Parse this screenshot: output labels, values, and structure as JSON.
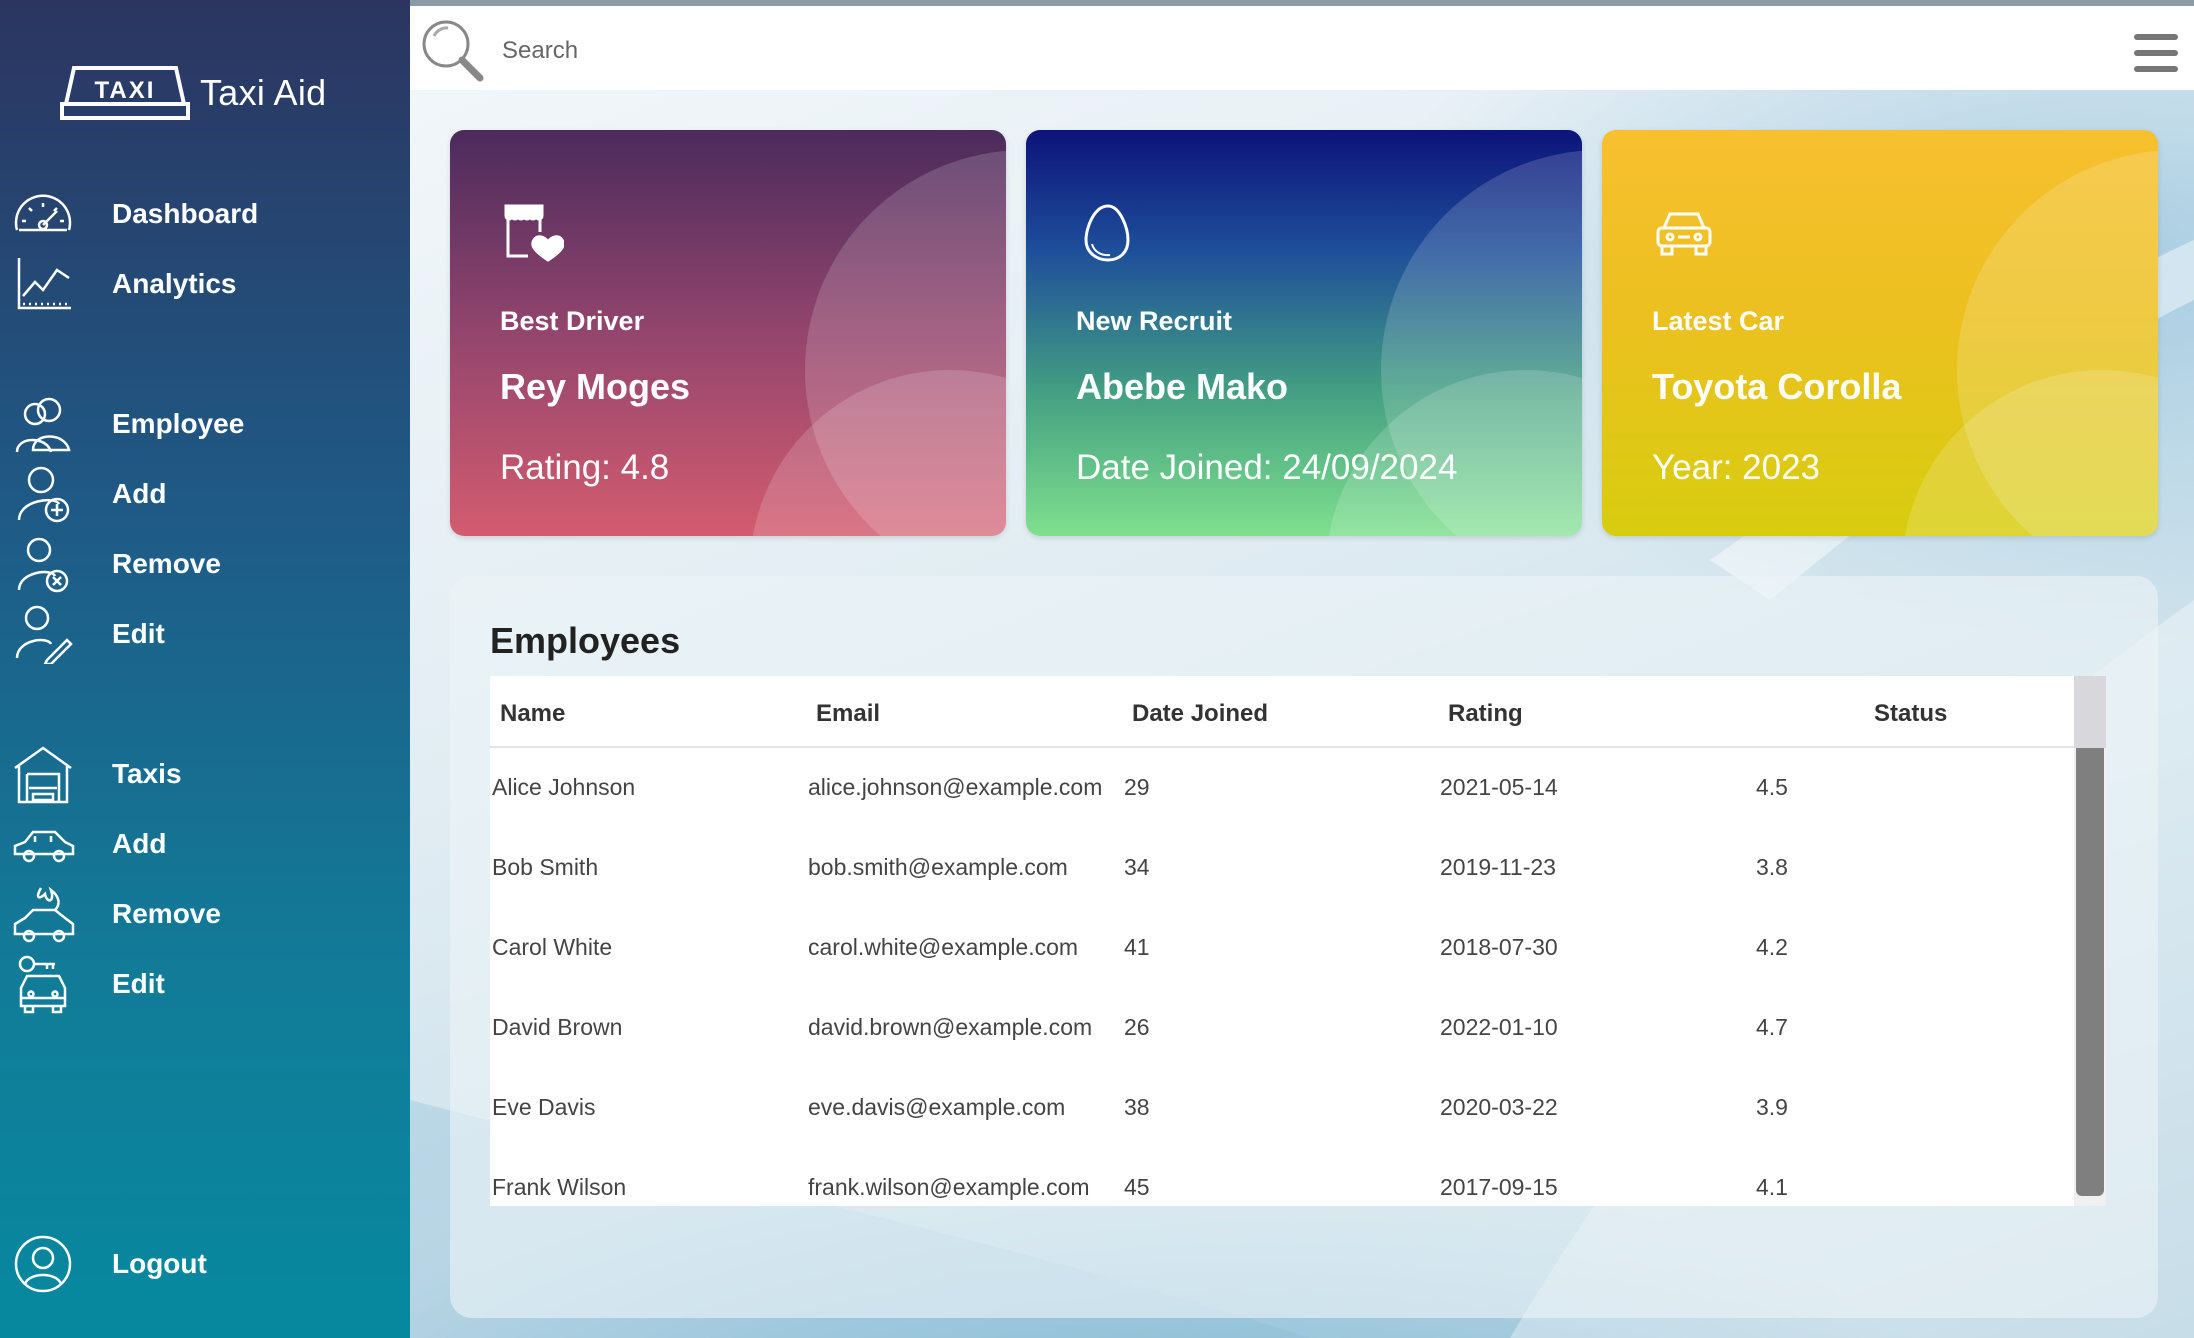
{
  "app": {
    "name": "Taxi Aid",
    "logo_text": "TAXI"
  },
  "sidebar": {
    "items": [
      {
        "id": "dashboard",
        "label": "Dashboard",
        "icon": "speedometer-icon"
      },
      {
        "id": "analytics",
        "label": "Analytics",
        "icon": "line-chart-icon"
      },
      {
        "id": "employee",
        "label": "Employee",
        "icon": "users-icon"
      },
      {
        "id": "employee-add",
        "label": "Add",
        "icon": "user-plus-icon"
      },
      {
        "id": "employee-remove",
        "label": "Remove",
        "icon": "user-remove-icon"
      },
      {
        "id": "employee-edit",
        "label": "Edit",
        "icon": "user-edit-icon"
      },
      {
        "id": "taxis",
        "label": "Taxis",
        "icon": "garage-icon"
      },
      {
        "id": "taxi-add",
        "label": "Add",
        "icon": "car-icon"
      },
      {
        "id": "taxi-remove",
        "label": "Remove",
        "icon": "car-fire-icon"
      },
      {
        "id": "taxi-edit",
        "label": "Edit",
        "icon": "car-key-icon"
      },
      {
        "id": "logout",
        "label": "Logout",
        "icon": "user-circle-icon"
      }
    ]
  },
  "search": {
    "placeholder": "Search",
    "icon": "search-icon"
  },
  "cards": {
    "best_driver": {
      "title": "Best Driver",
      "name": "Rey Moges",
      "meta": "Rating: 4.8",
      "icon": "store-heart-icon"
    },
    "new_recruit": {
      "title": "New Recruit",
      "name": "Abebe Mako",
      "meta": "Date Joined: 24/09/2024",
      "icon": "egg-icon"
    },
    "latest_car": {
      "title": "Latest Car",
      "name": "Toyota Corolla",
      "meta": "Year: 2023",
      "icon": "car-front-icon"
    }
  },
  "employees": {
    "title": "Employees",
    "columns": [
      "Name",
      "Email",
      "Date Joined",
      "Rating",
      "Status"
    ],
    "rows": [
      [
        "Alice Johnson",
        "alice.johnson@example.com",
        "29",
        "2021-05-14",
        "4.5"
      ],
      [
        "Bob Smith",
        "bob.smith@example.com",
        "34",
        "2019-11-23",
        "3.8"
      ],
      [
        "Carol White",
        "carol.white@example.com",
        "41",
        "2018-07-30",
        "4.2"
      ],
      [
        "David Brown",
        "david.brown@example.com",
        "26",
        "2022-01-10",
        "4.7"
      ],
      [
        "Eve Davis",
        "eve.davis@example.com",
        "38",
        "2020-03-22",
        "3.9"
      ],
      [
        "Frank Wilson",
        "frank.wilson@example.com",
        "45",
        "2017-09-15",
        "4.1"
      ]
    ]
  },
  "colors": {
    "sidebar_top": "#2b3560",
    "sidebar_bottom": "#06899f",
    "card_best_driver": "#d35c6f",
    "card_new_recruit": "#1e4f9a",
    "card_latest_car": "#f7c02f"
  }
}
